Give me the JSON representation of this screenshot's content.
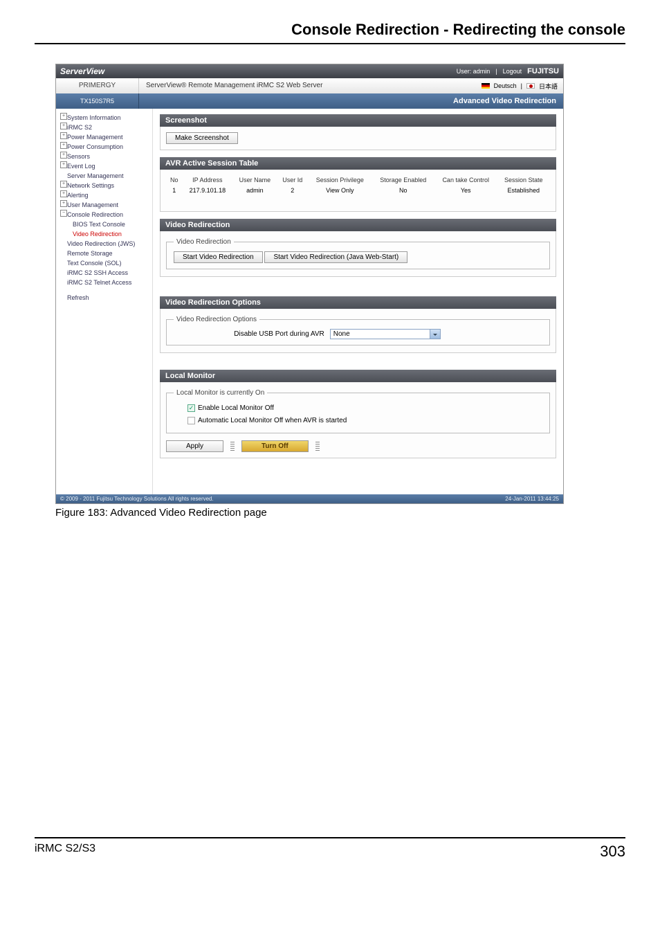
{
  "doc": {
    "heading": "Console Redirection - Redirecting the console"
  },
  "topbar": {
    "logo": "ServerView",
    "user_prefix": "User:",
    "user": "admin",
    "logout": "Logout",
    "brand": "FUJITSU"
  },
  "header2": {
    "left": "PRIMERGY",
    "mid": "ServerView® Remote Management iRMC S2 Web Server",
    "lang_de": "Deutsch",
    "lang_jp": "日本語"
  },
  "subbar": {
    "left": "TX150S7R5",
    "right": "Advanced Video Redirection"
  },
  "nav": {
    "i0": "System Information",
    "i1": "iRMC S2",
    "i2": "Power Management",
    "i3": "Power Consumption",
    "i4": "Sensors",
    "i5": "Event Log",
    "i6": "Server Management",
    "i7": "Network Settings",
    "i8": "Alerting",
    "i9": "User Management",
    "i10": "Console Redirection",
    "i10a": "BIOS Text Console",
    "i10b": "Video Redirection",
    "i11": "Video Redirection (JWS)",
    "i12": "Remote Storage",
    "i13": "Text Console (SOL)",
    "i14": "iRMC S2 SSH Access",
    "i15": "iRMC S2 Telnet Access",
    "i16": "Refresh"
  },
  "p1": {
    "title": "Screenshot",
    "btn": "Make Screenshot"
  },
  "p2": {
    "title": "AVR Active Session Table",
    "h_no": "No",
    "h_ip": "IP Address",
    "h_uname": "User Name",
    "h_uid": "User Id",
    "h_priv": "Session Privilege",
    "h_stor": "Storage Enabled",
    "h_ctrl": "Can take Control",
    "h_state": "Session State",
    "r_no": "1",
    "r_ip": "217.9.101.18",
    "r_uname": "admin",
    "r_uid": "2",
    "r_priv": "View Only",
    "r_stor": "No",
    "r_ctrl": "Yes",
    "r_state": "Established"
  },
  "p3": {
    "title": "Video Redirection",
    "legend": "Video Redirection",
    "b1": "Start Video Redirection",
    "b2": "Start Video Redirection (Java Web-Start)"
  },
  "p4": {
    "title": "Video Redirection Options",
    "legend": "Video Redirection Options",
    "label": "Disable USB Port during AVR",
    "sel": "None"
  },
  "p5": {
    "title": "Local Monitor",
    "legend": "Local Monitor is currently On",
    "chk1": "Enable Local Monitor Off",
    "chk2": "Automatic Local Monitor Off when AVR is started",
    "apply": "Apply",
    "turn": "Turn Off"
  },
  "footerCopy": "© 2009 - 2011 Fujitsu Technology Solutions  All rights reserved.",
  "footerTime": "24-Jan-2011  13:44:25",
  "caption": "Figure 183: Advanced Video Redirection page",
  "pagefoot": {
    "left": "iRMC S2/S3",
    "right": "303"
  }
}
